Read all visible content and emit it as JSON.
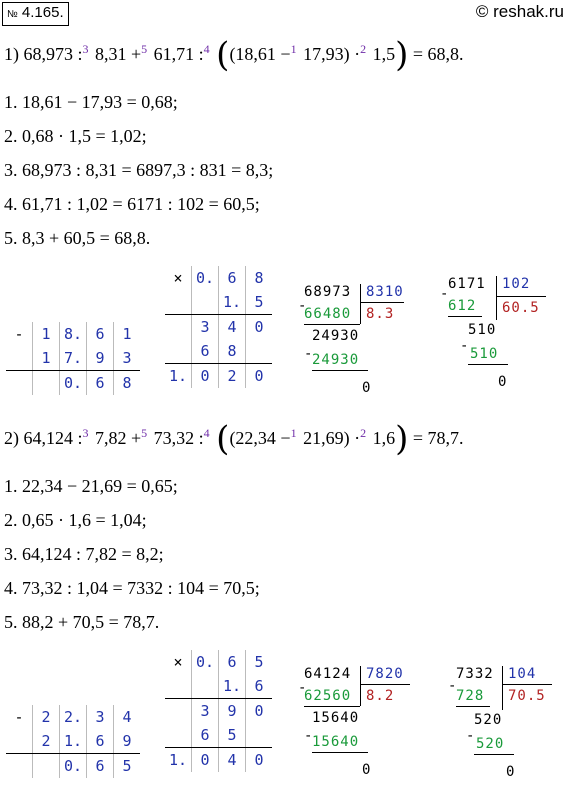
{
  "header": {
    "badge_prefix": "№",
    "badge_number": "4.165.",
    "site": "© reshak.ru"
  },
  "p1": {
    "label": "1) 68,973 :",
    "o1": "3",
    "t1": " 8,31 +",
    "o2": "5",
    "t2": " 61,71 :",
    "o3": "4",
    "t3": "(18,61 −",
    "o4": "1",
    "t4": " 17,93)",
    "t5": " ·",
    "o5": "2",
    "t6": " 1,5",
    "result": " = 68,8.",
    "steps": [
      "1.  18,61 − 17,93 = 0,68;",
      "2.  0,68 · 1,5 = 1,02;",
      "3.  68,973 : 8,31 = 6897,3 : 831 = 8,3;",
      "4.  61,71 : 1,02 = 6171 : 102 = 60,5;",
      "5.  8,3 + 60,5 = 68,8."
    ],
    "sub": {
      "sign": "-",
      "r1": [
        "1",
        "8.",
        "6",
        "1"
      ],
      "r2": [
        "1",
        "7.",
        "9",
        "3"
      ],
      "r3": [
        "",
        "0.",
        "6",
        "8"
      ]
    },
    "mul": {
      "sign": "×",
      "r1": [
        "0.",
        "6",
        "8"
      ],
      "r2": [
        "",
        "1.",
        "5"
      ],
      "r3": [
        "",
        "3",
        "4",
        "0"
      ],
      "r4": [
        "",
        "6",
        "8",
        ""
      ],
      "r5": [
        "1.",
        "0",
        "2",
        "0"
      ]
    },
    "div1": {
      "dividend": "68973",
      "divisor": "8310",
      "sub1": "66480",
      "quot": "8.3",
      "rem1": "24930",
      "sub2": "24930",
      "rem2": "0"
    },
    "div2": {
      "dividend": "6171",
      "divisor": "102",
      "sub1": "612",
      "quot": "60.5",
      "rem1": "510",
      "sub2": "510",
      "rem2": "0"
    }
  },
  "p2": {
    "label": "2) 64,124 :",
    "o1": "3",
    "t1": " 7,82 +",
    "o2": "5",
    "t2": " 73,32 :",
    "o3": "4",
    "t3": "(22,34 −",
    "o4": "1",
    "t4": " 21,69)",
    "t5": " ·",
    "o5": "2",
    "t6": " 1,6",
    "result": " = 78,7.",
    "steps": [
      "1.  22,34 − 21,69 = 0,65;",
      "2.  0,65 · 1,6 = 1,04;",
      "3.  64,124 : 7,82 = 8,2;",
      "4.  73,32 : 1,04 = 7332 : 104 = 70,5;",
      "5.  88,2 + 70,5 = 78,7."
    ],
    "sub": {
      "sign": "-",
      "r1": [
        "2",
        "2.",
        "3",
        "4"
      ],
      "r2": [
        "2",
        "1.",
        "6",
        "9"
      ],
      "r3": [
        "",
        "0.",
        "6",
        "5"
      ]
    },
    "mul": {
      "sign": "×",
      "r1": [
        "0.",
        "6",
        "5"
      ],
      "r2": [
        "",
        "1.",
        "6"
      ],
      "r3": [
        "",
        "3",
        "9",
        "0"
      ],
      "r4": [
        "",
        "6",
        "5",
        ""
      ],
      "r5": [
        "1.",
        "0",
        "4",
        "0"
      ]
    },
    "div1": {
      "dividend": "64124",
      "divisor": "7820",
      "sub1": "62560",
      "quot": "8.2",
      "rem1": "15640",
      "sub2": "15640",
      "rem2": "0"
    },
    "div2": {
      "dividend": "7332",
      "divisor": "104",
      "sub1": "728",
      "quot": "70.5",
      "rem1": "520",
      "sub2": "520",
      "rem2": "0"
    }
  }
}
